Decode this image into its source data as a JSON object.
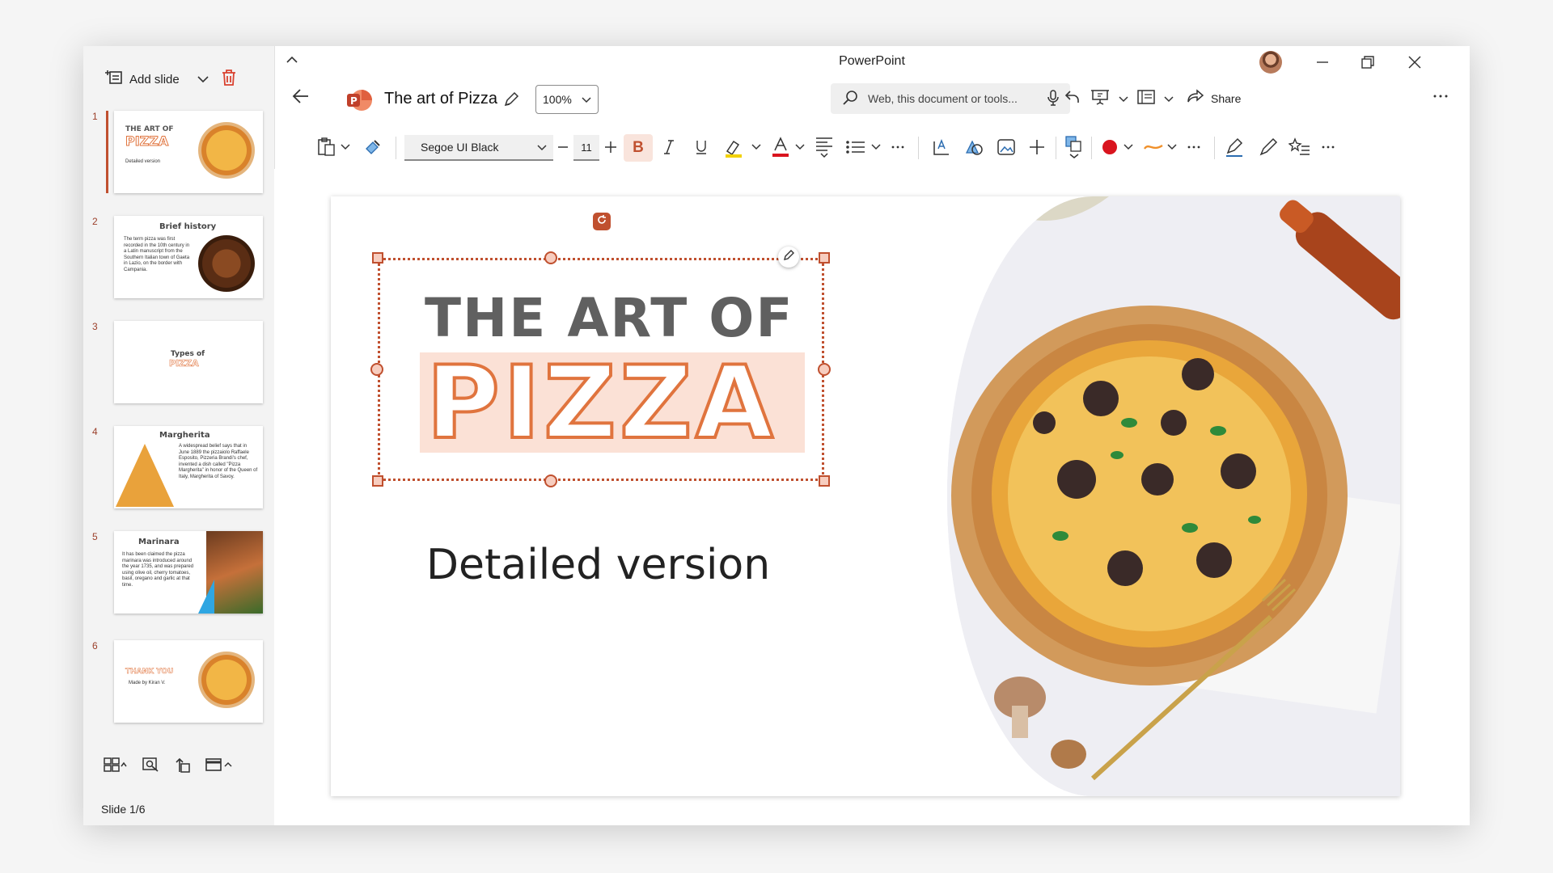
{
  "app": {
    "title": "PowerPoint"
  },
  "document": {
    "title": "The art of Pizza"
  },
  "toolbar": {
    "zoom": "100%",
    "search_placeholder": "Web, this document or tools...",
    "share_label": "Share"
  },
  "ribbon": {
    "font": "Segoe UI Black",
    "size": "11",
    "bold_label": "B"
  },
  "sidebar": {
    "add_slide_label": "Add slide",
    "slide_count": "Slide 1/6",
    "slides": [
      {
        "num": "1",
        "title": "THE ART OF",
        "title2": "PIZZA",
        "text": "Detailed version"
      },
      {
        "num": "2",
        "title": "Brief history",
        "text": "The term pizza was first recorded in the 10th century in a Latin manuscript from the Southern Italian town of Gaeta in Lazio, on the border with Campania."
      },
      {
        "num": "3",
        "title": "Types of",
        "title2": "PIZZA"
      },
      {
        "num": "4",
        "title": "Margherita",
        "text": "A widespread belief says that in June 1889 the pizzaiolo Raffaele Esposito, Pizzeria Brandi's chef, invented a dish called \"Pizza Margherita\" in honor of the Queen of Italy, Margherita of Savoy."
      },
      {
        "num": "5",
        "title": "Marinara",
        "text": "It has been claimed the pizza marinara was introduced around the year 1735, and was prepared using olive oil, cherry tomatoes, basil, oregano and garlic at that time."
      },
      {
        "num": "6",
        "title": "THANK YOU",
        "text": "Made by Kiran V."
      }
    ]
  },
  "slide": {
    "title_line1": "THE ART OF",
    "title_line2": "PIZZA",
    "subtitle": "Detailed version"
  },
  "colors": {
    "accent": "#c0502f",
    "pizza_outline": "#e0743e",
    "highlight": "#fbe1d6"
  }
}
